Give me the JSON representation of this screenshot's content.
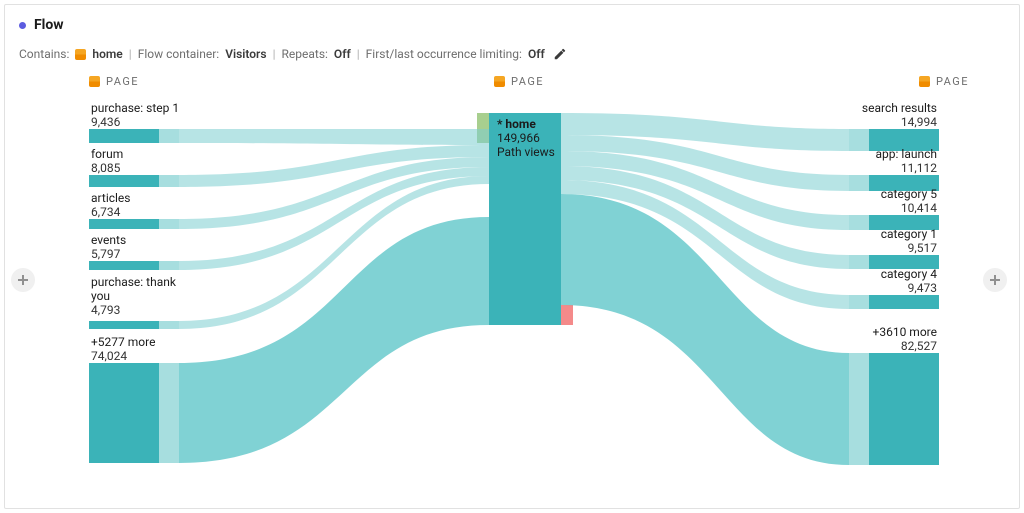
{
  "panel": {
    "title": "Flow"
  },
  "meta": {
    "contains_label": "Contains:",
    "contains_value": "home",
    "container_label": "Flow container:",
    "container_value": "Visitors",
    "repeats_label": "Repeats:",
    "repeats_value": "Off",
    "limiting_label": "First/last occurrence limiting:",
    "limiting_value": "Off"
  },
  "columns": {
    "left_header": "PAGE",
    "center_header": "PAGE",
    "right_header": "PAGE"
  },
  "center": {
    "title": "* home",
    "value": "149,966",
    "subtitle": "Path views"
  },
  "left_nodes": [
    {
      "label": "purchase: step 1",
      "value": "9,436"
    },
    {
      "label": "forum",
      "value": "8,085"
    },
    {
      "label": "articles",
      "value": "6,734"
    },
    {
      "label": "events",
      "value": "5,797"
    },
    {
      "label": "purchase: thank you",
      "value": "4,793"
    },
    {
      "label": "+5277 more",
      "value": "74,024"
    }
  ],
  "right_nodes": [
    {
      "label": "search results",
      "value": "14,994"
    },
    {
      "label": "app: launch",
      "value": "11,112"
    },
    {
      "label": "category 5",
      "value": "10,414"
    },
    {
      "label": "category 1",
      "value": "9,517"
    },
    {
      "label": "category 4",
      "value": "9,473"
    },
    {
      "label": "+3610 more",
      "value": "82,527"
    }
  ],
  "chart_data": {
    "type": "sankey",
    "title": "Flow",
    "center_node": {
      "name": "home",
      "path_views": 149966
    },
    "incoming": [
      {
        "name": "purchase: step 1",
        "value": 9436
      },
      {
        "name": "forum",
        "value": 8085
      },
      {
        "name": "articles",
        "value": 6734
      },
      {
        "name": "events",
        "value": 5797
      },
      {
        "name": "purchase: thank you",
        "value": 4793
      },
      {
        "name": "+5277 more",
        "value": 74024
      }
    ],
    "outgoing": [
      {
        "name": "search results",
        "value": 14994
      },
      {
        "name": "app: launch",
        "value": 11112
      },
      {
        "name": "category 5",
        "value": 10414
      },
      {
        "name": "category 1",
        "value": 9517
      },
      {
        "name": "category 4",
        "value": 9473
      },
      {
        "name": "+3610 more",
        "value": 82527
      }
    ]
  }
}
